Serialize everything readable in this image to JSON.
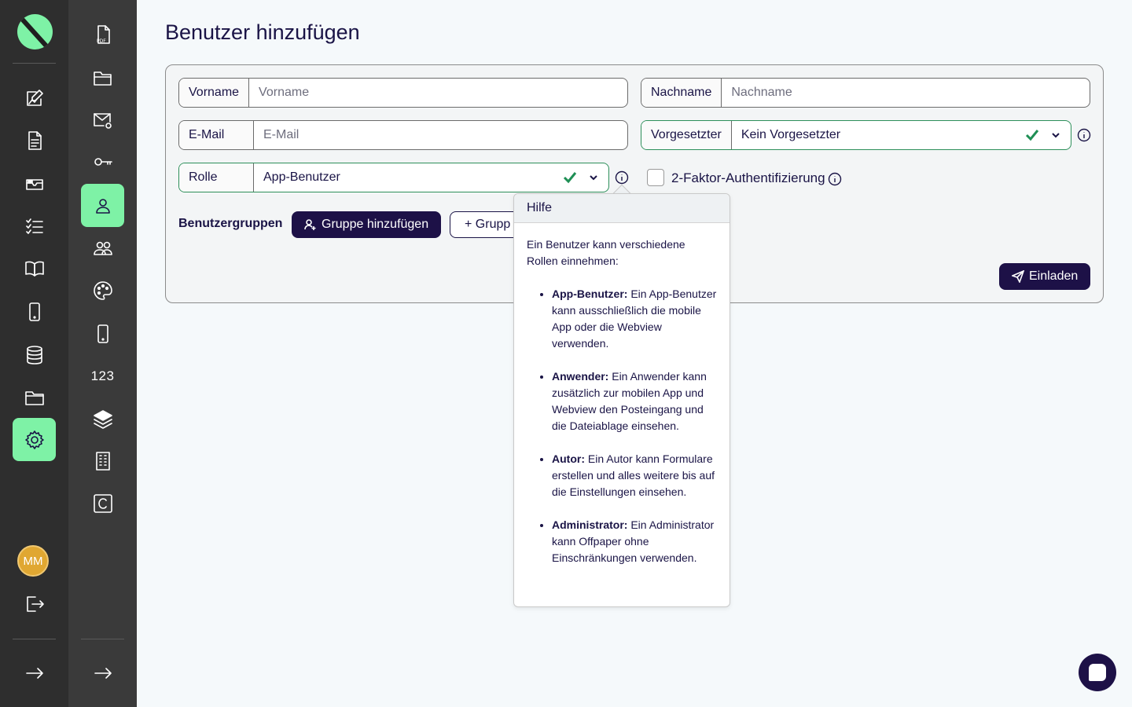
{
  "page": {
    "title": "Benutzer hinzufügen"
  },
  "sidebar_primary": {
    "items": [
      "edit-form-icon",
      "document-icon",
      "inbox-icon",
      "checklist-icon",
      "book-icon",
      "mobile-icon",
      "database-icon",
      "folder-icon",
      "settings-icon"
    ],
    "active": "settings-icon",
    "avatar_initials": "MM"
  },
  "sidebar_secondary": {
    "items": [
      "pdf-file-icon",
      "folder-open-icon",
      "mail-at-icon",
      "key-icon",
      "user-icon",
      "users-icon",
      "palette-icon",
      "mobile-icon",
      "numbers",
      "layers-icon",
      "building-icon",
      "copyright-c-icon"
    ],
    "numbers_label": "123",
    "active": "user-icon"
  },
  "form": {
    "vorname": {
      "label": "Vorname",
      "placeholder": "Vorname"
    },
    "nachname": {
      "label": "Nachname",
      "placeholder": "Nachname"
    },
    "email": {
      "label": "E-Mail",
      "placeholder": "E-Mail"
    },
    "vorgesetzter": {
      "label": "Vorgesetzter",
      "value": "Kein Vorgesetzter"
    },
    "rolle": {
      "label": "Rolle",
      "value": "App-Benutzer"
    },
    "two_factor_label": "2-Faktor-Authentifizierung",
    "groups_label": "Benutzergruppen",
    "add_group_button": "Gruppe hinzufügen",
    "new_group_button": "+ Grupp",
    "invite_button": "Einladen"
  },
  "help_popover": {
    "title": "Hilfe",
    "intro": "Ein Benutzer kann verschiedene Rollen einnehmen:",
    "roles": [
      {
        "name": "App-Benutzer:",
        "text": " Ein App-Benutzer kann ausschließlich die mobile App oder die Webview verwenden."
      },
      {
        "name": "Anwender:",
        "text": " Ein Anwender kann zusätzlich zur mobilen App und Webview den Posteingang und die Dateiablage einsehen."
      },
      {
        "name": "Autor:",
        "text": " Ein Autor kann Formulare erstellen und alles weitere bis auf die Einstellungen einsehen."
      },
      {
        "name": "Administrator:",
        "text": " Ein Administrator kann Offpaper ohne Einschränkungen verwenden."
      }
    ]
  },
  "colors": {
    "accent_green": "#7ef2a6",
    "primary_dark": "#1d1147",
    "valid_green": "#1f8f55"
  }
}
